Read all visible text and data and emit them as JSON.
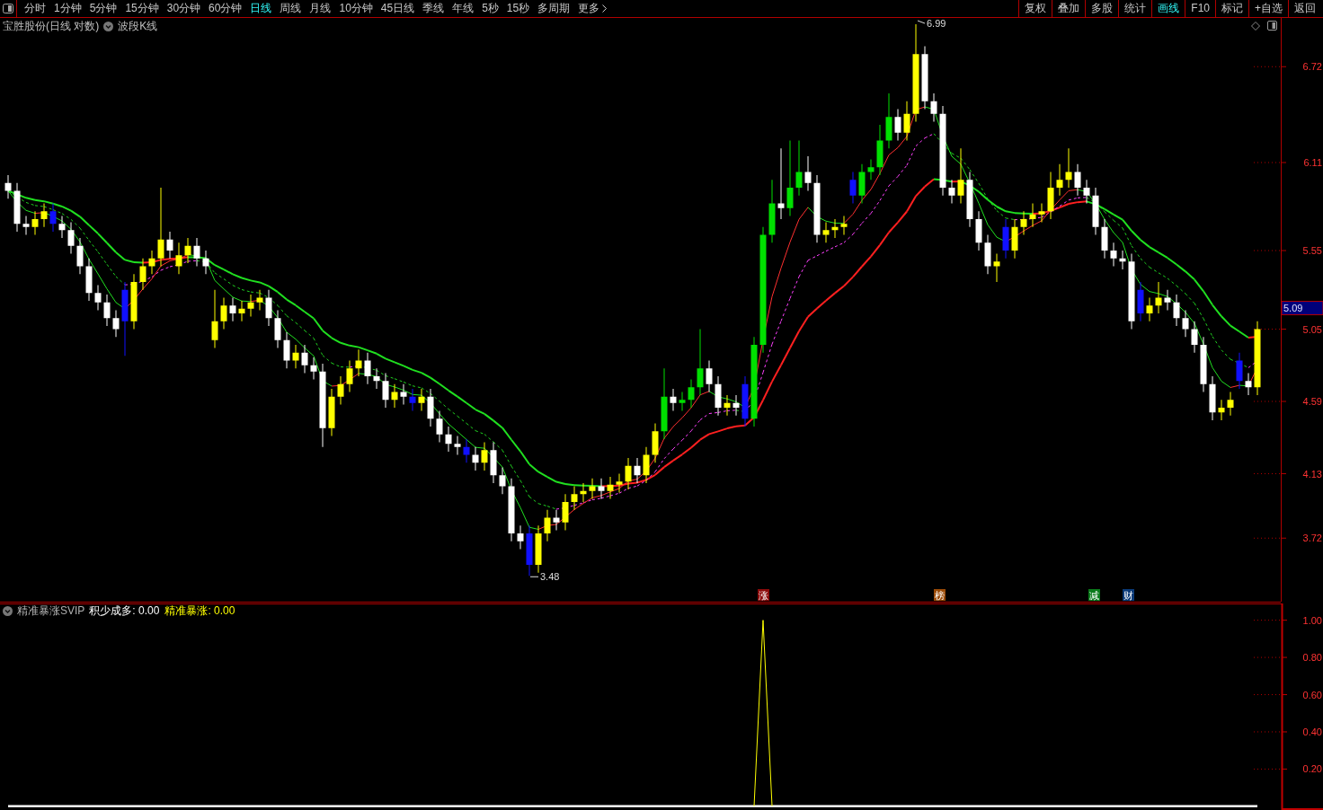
{
  "toolbar": {
    "periods": [
      {
        "label": "分时",
        "selected": false
      },
      {
        "label": "1分钟",
        "selected": false
      },
      {
        "label": "5分钟",
        "selected": false
      },
      {
        "label": "15分钟",
        "selected": false
      },
      {
        "label": "30分钟",
        "selected": false
      },
      {
        "label": "60分钟",
        "selected": false
      },
      {
        "label": "日线",
        "selected": true
      },
      {
        "label": "周线",
        "selected": false
      },
      {
        "label": "月线",
        "selected": false
      },
      {
        "label": "10分钟",
        "selected": false
      },
      {
        "label": "45日线",
        "selected": false
      },
      {
        "label": "季线",
        "selected": false
      },
      {
        "label": "年线",
        "selected": false
      },
      {
        "label": "5秒",
        "selected": false
      },
      {
        "label": "15秒",
        "selected": false
      },
      {
        "label": "多周期",
        "selected": false
      }
    ],
    "more": "更多",
    "actions": [
      {
        "label": "复权",
        "selected": false
      },
      {
        "label": "叠加",
        "selected": false
      },
      {
        "label": "多股",
        "selected": false
      },
      {
        "label": "统计",
        "selected": false
      },
      {
        "label": "画线",
        "selected": true
      },
      {
        "label": "F10",
        "selected": false
      },
      {
        "label": "标记",
        "selected": false
      },
      {
        "label": "+自选",
        "selected": false
      },
      {
        "label": "返回",
        "selected": false
      }
    ]
  },
  "chart_header": {
    "title": "宝胜股份(日线 对数)",
    "indicator": "波段K线"
  },
  "main_chart": {
    "current_price": "5.09",
    "high_label": "6.99",
    "low_label": "3.48",
    "event_markers": [
      {
        "label": "涨",
        "color": "#8b0a0a"
      },
      {
        "label": "榜",
        "color": "#9a4a06"
      },
      {
        "label": "减",
        "color": "#0a7a1a"
      },
      {
        "label": "财",
        "color": "#0a3a78"
      }
    ],
    "chart_data": {
      "type": "candlestick",
      "ylim": [
        3.31,
        7.03
      ],
      "yticks": [
        {
          "value": 6.72,
          "label": "6.72"
        },
        {
          "value": 6.11,
          "label": "6.11"
        },
        {
          "value": 5.55,
          "label": "5.55"
        },
        {
          "value": 5.05,
          "label": "5.05"
        },
        {
          "value": 4.59,
          "label": "4.59"
        },
        {
          "value": 4.13,
          "label": "4.13"
        },
        {
          "value": 3.72,
          "label": "3.72"
        }
      ],
      "categories": [
        null,
        null,
        null,
        null,
        null,
        null,
        null,
        null,
        null,
        null,
        null,
        null,
        null,
        null,
        null,
        null,
        null,
        null,
        null,
        null,
        null,
        null,
        null,
        null,
        null,
        null,
        null,
        null,
        null,
        null,
        null,
        null,
        null,
        null,
        null,
        null,
        null,
        null,
        null,
        null,
        null,
        null,
        null,
        null,
        null,
        null,
        null,
        null,
        null,
        null,
        null,
        null,
        null,
        null,
        null,
        null,
        null,
        null,
        null,
        null,
        null,
        null,
        null,
        null,
        null,
        null,
        null,
        null,
        null,
        null,
        null,
        null,
        null,
        null,
        null,
        null,
        null,
        null,
        null,
        null,
        null,
        null,
        null,
        null,
        null,
        null,
        null,
        null,
        null,
        null,
        null,
        null,
        null,
        null,
        null,
        null,
        null,
        null,
        null,
        null,
        null,
        null,
        null,
        null,
        null,
        null,
        null,
        null,
        null,
        null,
        null,
        null,
        null,
        null,
        null,
        null,
        null,
        null,
        null,
        null,
        null,
        null,
        null,
        null,
        null,
        null,
        null,
        null,
        null,
        null,
        null,
        null,
        null,
        null,
        null,
        null,
        null,
        null,
        null,
        null
      ],
      "ohlc": [
        [
          5.98,
          6.03,
          5.88,
          5.93
        ],
        [
          5.93,
          5.98,
          5.67,
          5.72
        ],
        [
          5.72,
          5.77,
          5.65,
          5.7
        ],
        [
          5.7,
          5.8,
          5.65,
          5.75
        ],
        [
          5.75,
          5.85,
          5.7,
          5.8
        ],
        [
          5.8,
          5.85,
          5.67,
          5.72
        ],
        [
          5.72,
          5.77,
          5.63,
          5.68
        ],
        [
          5.68,
          5.73,
          5.53,
          5.58
        ],
        [
          5.58,
          5.63,
          5.4,
          5.45
        ],
        [
          5.45,
          5.5,
          5.23,
          5.28
        ],
        [
          5.28,
          5.33,
          5.17,
          5.22
        ],
        [
          5.22,
          5.27,
          5.07,
          5.12
        ],
        [
          5.12,
          5.17,
          5.0,
          5.05
        ],
        [
          5.3,
          5.35,
          4.88,
          5.1
        ],
        [
          5.1,
          5.4,
          5.05,
          5.35
        ],
        [
          5.35,
          5.5,
          5.3,
          5.45
        ],
        [
          5.45,
          5.55,
          5.4,
          5.5
        ],
        [
          5.5,
          5.95,
          5.45,
          5.62
        ],
        [
          5.62,
          5.67,
          5.5,
          5.55
        ],
        [
          5.45,
          5.6,
          5.4,
          5.52
        ],
        [
          5.52,
          5.63,
          5.47,
          5.58
        ],
        [
          5.58,
          5.63,
          5.45,
          5.5
        ],
        [
          5.5,
          5.55,
          5.4,
          5.45
        ],
        [
          4.98,
          5.3,
          4.93,
          5.1
        ],
        [
          5.1,
          5.25,
          5.05,
          5.2
        ],
        [
          5.2,
          5.25,
          5.1,
          5.15
        ],
        [
          5.15,
          5.23,
          5.1,
          5.18
        ],
        [
          5.18,
          5.27,
          5.13,
          5.22
        ],
        [
          5.22,
          5.3,
          5.17,
          5.25
        ],
        [
          5.25,
          5.3,
          5.07,
          5.12
        ],
        [
          5.12,
          5.17,
          4.93,
          4.98
        ],
        [
          4.98,
          5.03,
          4.8,
          4.85
        ],
        [
          4.85,
          4.95,
          4.8,
          4.9
        ],
        [
          4.9,
          4.95,
          4.77,
          4.82
        ],
        [
          4.82,
          4.87,
          4.73,
          4.78
        ],
        [
          4.78,
          4.83,
          4.3,
          4.42
        ],
        [
          4.42,
          4.67,
          4.37,
          4.62
        ],
        [
          4.62,
          4.75,
          4.57,
          4.7
        ],
        [
          4.7,
          4.85,
          4.65,
          4.8
        ],
        [
          4.8,
          4.92,
          4.75,
          4.85
        ],
        [
          4.85,
          4.9,
          4.7,
          4.75
        ],
        [
          4.75,
          4.8,
          4.67,
          4.72
        ],
        [
          4.72,
          4.77,
          4.55,
          4.6
        ],
        [
          4.6,
          4.7,
          4.55,
          4.65
        ],
        [
          4.65,
          4.7,
          4.57,
          4.62
        ],
        [
          4.62,
          4.67,
          4.53,
          4.58
        ],
        [
          4.58,
          4.67,
          4.53,
          4.62
        ],
        [
          4.62,
          4.67,
          4.43,
          4.48
        ],
        [
          4.48,
          4.53,
          4.33,
          4.38
        ],
        [
          4.38,
          4.43,
          4.27,
          4.32
        ],
        [
          4.32,
          4.37,
          4.25,
          4.3
        ],
        [
          4.3,
          4.35,
          4.2,
          4.25
        ],
        [
          4.25,
          4.3,
          4.15,
          4.2
        ],
        [
          4.2,
          4.33,
          4.15,
          4.28
        ],
        [
          4.28,
          4.33,
          4.07,
          4.12
        ],
        [
          4.12,
          4.17,
          4.0,
          4.05
        ],
        [
          4.05,
          4.1,
          3.7,
          3.75
        ],
        [
          3.75,
          3.8,
          3.65,
          3.7
        ],
        [
          3.75,
          3.8,
          3.48,
          3.55
        ],
        [
          3.55,
          3.8,
          3.5,
          3.75
        ],
        [
          3.75,
          3.9,
          3.7,
          3.85
        ],
        [
          3.85,
          3.9,
          3.77,
          3.82
        ],
        [
          3.82,
          4.0,
          3.77,
          3.95
        ],
        [
          3.95,
          4.05,
          3.9,
          4.0
        ],
        [
          4.0,
          4.07,
          3.95,
          4.02
        ],
        [
          4.02,
          4.1,
          3.97,
          4.05
        ],
        [
          4.05,
          4.1,
          3.97,
          4.02
        ],
        [
          4.02,
          4.11,
          3.97,
          4.06
        ],
        [
          4.06,
          4.13,
          4.01,
          4.08
        ],
        [
          4.08,
          4.23,
          4.03,
          4.18
        ],
        [
          4.18,
          4.23,
          4.07,
          4.12
        ],
        [
          4.12,
          4.3,
          4.07,
          4.25
        ],
        [
          4.25,
          4.45,
          4.2,
          4.4
        ],
        [
          4.4,
          4.8,
          4.35,
          4.62
        ],
        [
          4.62,
          4.67,
          4.53,
          4.58
        ],
        [
          4.58,
          4.65,
          4.53,
          4.6
        ],
        [
          4.6,
          4.73,
          4.55,
          4.68
        ],
        [
          4.68,
          5.05,
          4.63,
          4.8
        ],
        [
          4.8,
          4.85,
          4.65,
          4.7
        ],
        [
          4.7,
          4.75,
          4.5,
          4.55
        ],
        [
          4.55,
          4.63,
          4.5,
          4.58
        ],
        [
          4.58,
          4.63,
          4.5,
          4.55
        ],
        [
          4.7,
          4.75,
          4.43,
          4.48
        ],
        [
          4.48,
          5.0,
          4.43,
          4.95
        ],
        [
          4.95,
          5.7,
          4.9,
          5.65
        ],
        [
          5.65,
          6.0,
          5.6,
          5.85
        ],
        [
          5.85,
          6.2,
          5.75,
          5.82
        ],
        [
          5.82,
          6.25,
          5.77,
          5.95
        ],
        [
          5.95,
          6.25,
          5.9,
          6.05
        ],
        [
          6.05,
          6.15,
          5.93,
          5.98
        ],
        [
          5.98,
          6.03,
          5.6,
          5.65
        ],
        [
          5.65,
          5.73,
          5.6,
          5.68
        ],
        [
          5.68,
          5.75,
          5.63,
          5.7
        ],
        [
          5.7,
          5.77,
          5.65,
          5.72
        ],
        [
          6.0,
          6.05,
          5.85,
          5.9
        ],
        [
          5.9,
          6.1,
          5.85,
          6.05
        ],
        [
          6.05,
          6.13,
          6.0,
          6.08
        ],
        [
          6.08,
          6.35,
          6.03,
          6.25
        ],
        [
          6.25,
          6.55,
          6.2,
          6.4
        ],
        [
          6.4,
          6.45,
          6.25,
          6.3
        ],
        [
          6.3,
          6.5,
          6.25,
          6.42
        ],
        [
          6.42,
          6.99,
          6.37,
          6.8
        ],
        [
          6.8,
          6.85,
          6.45,
          6.5
        ],
        [
          6.5,
          6.55,
          6.37,
          6.42
        ],
        [
          6.42,
          6.47,
          5.9,
          5.95
        ],
        [
          5.95,
          6.0,
          5.85,
          5.9
        ],
        [
          5.9,
          6.2,
          5.85,
          6.0
        ],
        [
          6.0,
          6.05,
          5.7,
          5.75
        ],
        [
          5.75,
          5.8,
          5.55,
          5.6
        ],
        [
          5.6,
          5.65,
          5.4,
          5.45
        ],
        [
          5.45,
          5.53,
          5.35,
          5.48
        ],
        [
          5.7,
          5.75,
          5.5,
          5.55
        ],
        [
          5.55,
          5.75,
          5.5,
          5.7
        ],
        [
          5.7,
          5.8,
          5.65,
          5.75
        ],
        [
          5.75,
          5.85,
          5.7,
          5.78
        ],
        [
          5.78,
          5.85,
          5.73,
          5.8
        ],
        [
          5.8,
          6.05,
          5.75,
          5.95
        ],
        [
          5.95,
          6.1,
          5.9,
          6.0
        ],
        [
          6.0,
          6.2,
          5.95,
          6.05
        ],
        [
          6.05,
          6.1,
          5.9,
          5.95
        ],
        [
          5.95,
          6.0,
          5.85,
          5.9
        ],
        [
          5.9,
          5.95,
          5.65,
          5.7
        ],
        [
          5.7,
          5.75,
          5.5,
          5.55
        ],
        [
          5.55,
          5.6,
          5.45,
          5.5
        ],
        [
          5.5,
          5.55,
          5.43,
          5.48
        ],
        [
          5.48,
          5.53,
          5.05,
          5.1
        ],
        [
          5.3,
          5.35,
          5.1,
          5.15
        ],
        [
          5.15,
          5.25,
          5.1,
          5.2
        ],
        [
          5.2,
          5.35,
          5.15,
          5.25
        ],
        [
          5.25,
          5.3,
          5.17,
          5.22
        ],
        [
          5.22,
          5.27,
          5.07,
          5.12
        ],
        [
          5.12,
          5.17,
          5.0,
          5.05
        ],
        [
          5.05,
          5.1,
          4.9,
          4.95
        ],
        [
          4.95,
          5.0,
          4.65,
          4.7
        ],
        [
          4.7,
          4.75,
          4.47,
          4.52
        ],
        [
          4.52,
          4.6,
          4.47,
          4.55
        ],
        [
          4.55,
          4.65,
          4.5,
          4.6
        ],
        [
          4.85,
          4.9,
          4.67,
          4.72
        ],
        [
          4.72,
          4.77,
          4.63,
          4.68
        ],
        [
          4.68,
          5.1,
          4.63,
          5.05
        ]
      ],
      "colors": [
        "#ffffff",
        "#ffffff",
        "#ffffff",
        "#ffff00",
        "#ffff00",
        "#1010ff",
        "#ffffff",
        "#ffffff",
        "#ffffff",
        "#ffffff",
        "#ffffff",
        "#ffffff",
        "#ffffff",
        "#1010ff",
        "#ffff00",
        "#ffff00",
        "#ffff00",
        "#ffff00",
        "#ffffff",
        "#ffff00",
        "#ffff00",
        "#ffffff",
        "#ffffff",
        "#ffff00",
        "#ffff00",
        "#ffffff",
        "#ffff00",
        "#ffff00",
        "#ffff00",
        "#ffffff",
        "#ffffff",
        "#ffffff",
        "#ffff00",
        "#ffffff",
        "#ffffff",
        "#ffffff",
        "#ffff00",
        "#ffff00",
        "#ffff00",
        "#ffff00",
        "#ffffff",
        "#ffffff",
        "#ffffff",
        "#ffff00",
        "#ffffff",
        "#1010ff",
        "#ffff00",
        "#ffffff",
        "#ffffff",
        "#ffffff",
        "#ffffff",
        "#1010ff",
        "#ffffff",
        "#ffff00",
        "#ffffff",
        "#ffffff",
        "#ffffff",
        "#ffffff",
        "#1010ff",
        "#ffff00",
        "#ffff00",
        "#ffffff",
        "#ffff00",
        "#ffff00",
        "#ffff00",
        "#ffff00",
        "#ffffff",
        "#ffff00",
        "#ffff00",
        "#ffff00",
        "#ffffff",
        "#ffff00",
        "#ffff00",
        "#00e000",
        "#ffffff",
        "#00e000",
        "#00e000",
        "#00e000",
        "#ffffff",
        "#ffffff",
        "#ffff00",
        "#ffffff",
        "#1010ff",
        "#00e000",
        "#00e000",
        "#00e000",
        "#ffffff",
        "#00e000",
        "#00e000",
        "#ffffff",
        "#ffffff",
        "#ffff00",
        "#ffff00",
        "#ffff00",
        "#1010ff",
        "#00e000",
        "#00e000",
        "#00e000",
        "#00e000",
        "#ffffff",
        "#ffff00",
        "#ffff00",
        "#ffffff",
        "#ffffff",
        "#ffffff",
        "#ffffff",
        "#ffff00",
        "#ffffff",
        "#ffffff",
        "#ffffff",
        "#ffff00",
        "#1010ff",
        "#ffff00",
        "#ffff00",
        "#ffff00",
        "#ffff00",
        "#ffff00",
        "#ffff00",
        "#ffff00",
        "#ffffff",
        "#ffffff",
        "#ffffff",
        "#ffffff",
        "#ffffff",
        "#ffffff",
        "#ffffff",
        "#1010ff",
        "#ffff00",
        "#ffff00",
        "#ffffff",
        "#ffffff",
        "#ffffff",
        "#ffffff",
        "#ffffff",
        "#ffffff",
        "#ffff00",
        "#ffff00",
        "#1010ff",
        "#ffffff",
        "#ffff00"
      ]
    }
  },
  "indicator_pane": {
    "name": "精准暴涨SVIP",
    "legend": [
      {
        "label": "积少成多: 0.00",
        "color": "#ffffff"
      },
      {
        "label": "精准暴涨: 0.00",
        "color": "#ffff00"
      }
    ],
    "chart_data": {
      "type": "line",
      "ylim": [
        -0.02,
        1.09
      ],
      "yticks": [
        {
          "value": 0.2,
          "label": "0.20"
        },
        {
          "value": 0.4,
          "label": "0.40"
        },
        {
          "value": 0.6,
          "label": "0.60"
        },
        {
          "value": 0.8,
          "label": "0.80"
        },
        {
          "value": 1,
          "label": "1.00"
        }
      ],
      "series": [
        {
          "color": "#ffffff",
          "values": [
            0,
            0,
            0,
            0,
            0,
            0,
            0,
            0,
            0,
            0,
            0,
            0,
            0,
            0,
            0,
            0,
            0,
            0,
            0,
            0,
            0,
            0,
            0,
            0,
            0,
            0,
            0,
            0,
            0,
            0,
            0,
            0,
            0,
            0,
            0,
            0,
            0,
            0,
            0,
            0,
            0,
            0,
            0,
            0,
            0,
            0,
            0,
            0,
            0,
            0,
            0,
            0,
            0,
            0,
            0,
            0,
            0,
            0,
            0,
            0,
            0,
            0,
            0,
            0,
            0,
            0,
            0,
            0,
            0,
            0,
            0,
            0,
            0,
            0,
            0,
            0,
            0,
            0,
            0,
            0,
            0,
            0,
            0,
            0,
            0,
            0,
            0,
            0,
            0,
            0,
            0,
            0,
            0,
            0,
            0,
            0,
            0,
            0,
            0,
            0,
            0,
            0,
            0,
            0,
            0,
            0,
            0,
            0,
            0,
            0,
            0,
            0,
            0,
            0,
            0,
            0,
            0,
            0,
            0,
            0,
            0,
            0,
            0,
            0,
            0,
            0,
            0,
            0,
            0,
            0,
            0,
            0,
            0,
            0,
            0,
            0,
            0,
            0,
            0,
            0
          ]
        },
        {
          "color": "#ffff00",
          "values": [
            null,
            null,
            null,
            null,
            null,
            null,
            null,
            null,
            null,
            null,
            null,
            null,
            null,
            null,
            null,
            null,
            null,
            null,
            null,
            null,
            null,
            null,
            null,
            null,
            null,
            null,
            null,
            null,
            null,
            null,
            null,
            null,
            null,
            null,
            null,
            null,
            null,
            null,
            null,
            null,
            null,
            null,
            null,
            null,
            null,
            null,
            null,
            null,
            null,
            null,
            null,
            null,
            null,
            null,
            null,
            null,
            null,
            null,
            null,
            null,
            null,
            null,
            null,
            null,
            null,
            null,
            null,
            null,
            null,
            null,
            null,
            null,
            null,
            null,
            null,
            null,
            null,
            null,
            null,
            null,
            null,
            null,
            null,
            0,
            1,
            0,
            null,
            null,
            null,
            null,
            null,
            null,
            null,
            null,
            null,
            null,
            null,
            null,
            null,
            null,
            null,
            null,
            null,
            null,
            null,
            null,
            null,
            null,
            null,
            null,
            null,
            null,
            null,
            null,
            null,
            null,
            null,
            null,
            null,
            null,
            null,
            null,
            null,
            null,
            null,
            null,
            null,
            null,
            null,
            null,
            null,
            null,
            null,
            null,
            null,
            null,
            null,
            null,
            null,
            null
          ]
        }
      ]
    }
  }
}
